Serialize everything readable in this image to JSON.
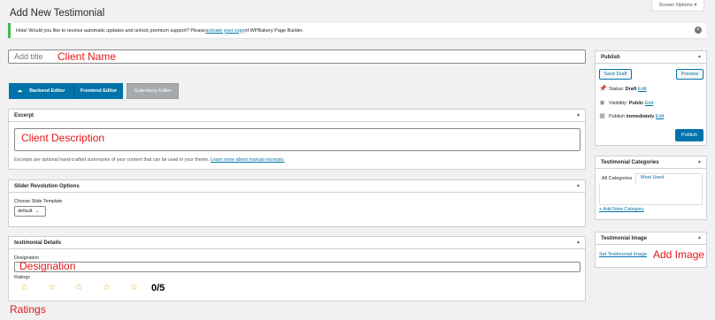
{
  "page": {
    "title": "Add New Testimonial",
    "screen_options": "Screen Options"
  },
  "notice": {
    "text_before": "Hola! Would you like to receive automatic updates and unlock premium support? Please ",
    "link": "activate your copy",
    "text_after": " of WPBakery Page Builder."
  },
  "title_field": {
    "placeholder": "Add title"
  },
  "annotations": {
    "client_name": "Client Name",
    "client_description": "Client Description",
    "designation": "Designation",
    "ratings": "Ratings",
    "add_image": "Add Image"
  },
  "editor_buttons": {
    "backend": "Backend Editor",
    "frontend": "Frontend Editor",
    "gutenberg": "Gutenberg Editor"
  },
  "excerpt": {
    "title": "Excerpt",
    "help_text": "Excerpts are optional hand-crafted summaries of your content that can be used in your theme. ",
    "help_link": "Learn more about manual excerpts."
  },
  "slider": {
    "title": "Slider Revolution Options",
    "choose_label": "Choose Slide Template",
    "selected": "default"
  },
  "details": {
    "title": "testimonial Details",
    "designation_label": "Designation",
    "ratings_label": "Ratings",
    "rating_value": "0/5",
    "stars_total": 5,
    "stars_filled": 0
  },
  "publish": {
    "title": "Publish",
    "save_draft": "Save Draft",
    "preview": "Preview",
    "status_label": "Status: ",
    "status_value": "Draft",
    "visibility_label": "Visibility: ",
    "visibility_value": "Public",
    "publish_label": "Publish ",
    "publish_value": "immediately",
    "edit": "Edit",
    "publish_button": "Publish"
  },
  "categories": {
    "title": "Testimonial Categories",
    "tab_all": "All Categories",
    "tab_used": "Most Used",
    "add_new": "+ Add New Category"
  },
  "image": {
    "title": "Testimonial Image",
    "set_link": "Set Testimonial Image"
  },
  "colors": {
    "accent": "#0073aa",
    "annotation_red": "#e3161a",
    "star": "#e8a21e",
    "notice_border": "#46b450"
  }
}
